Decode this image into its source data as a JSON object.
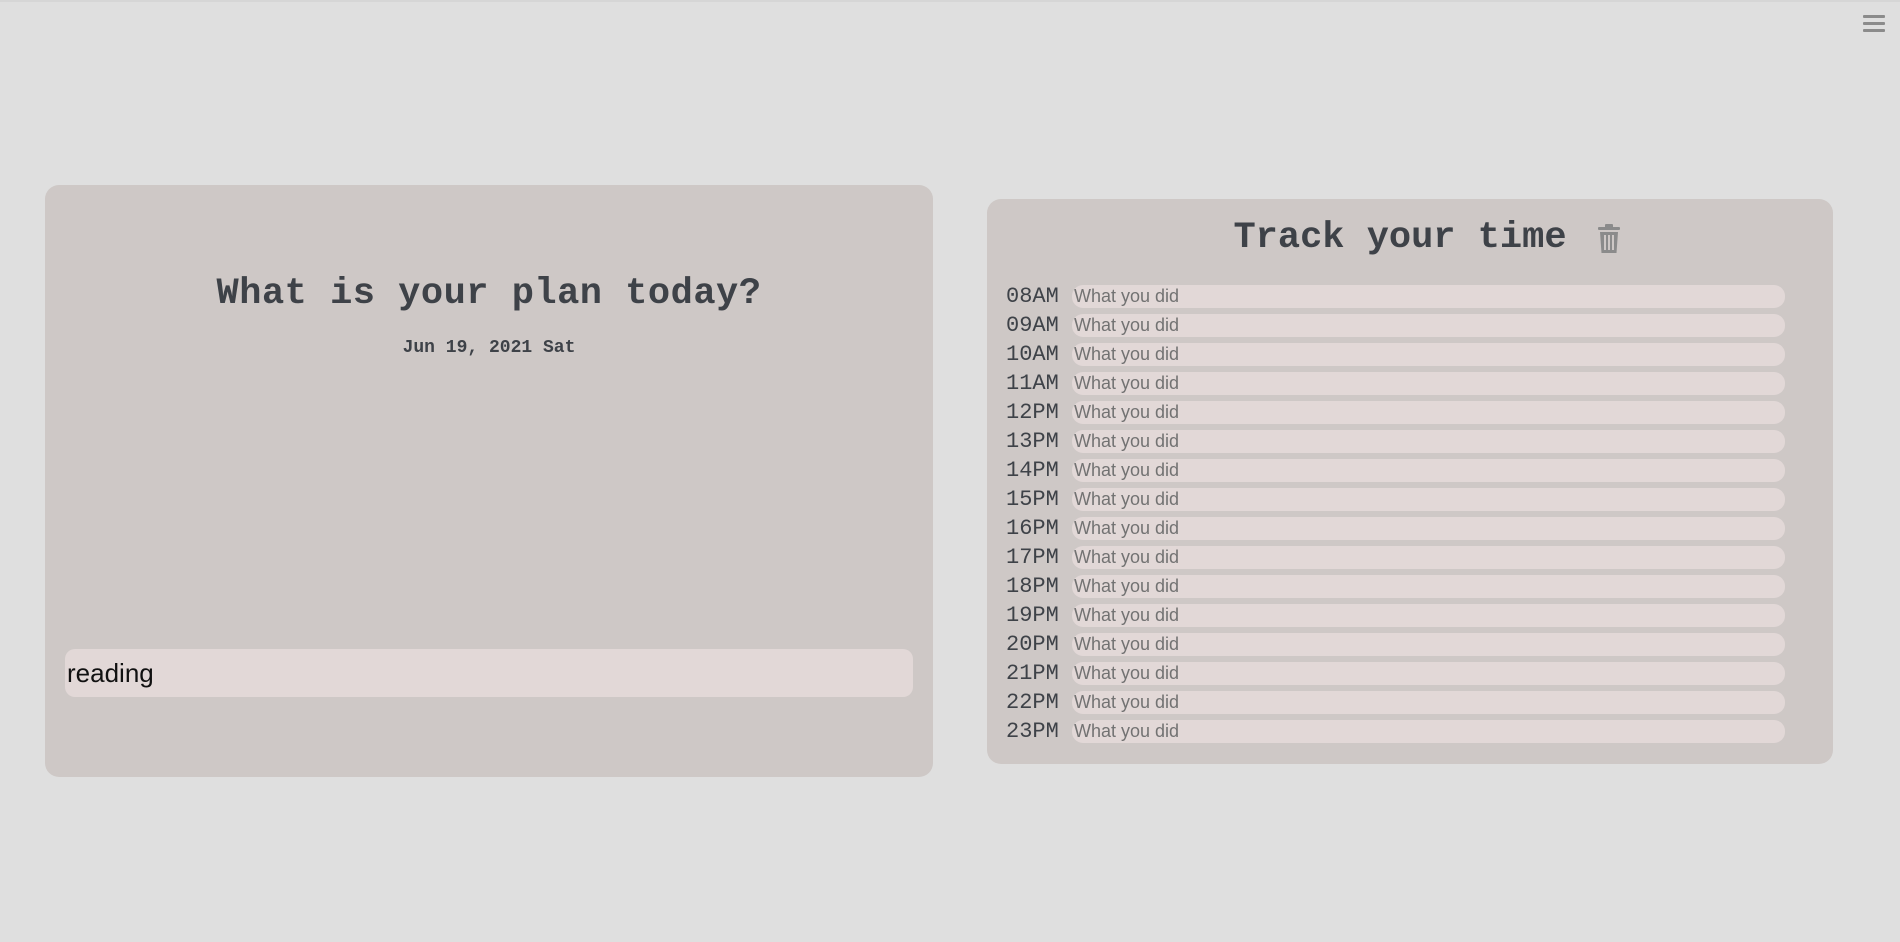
{
  "plan": {
    "title": "What is your plan today?",
    "date": "Jun 19, 2021 Sat",
    "input_value": "reading"
  },
  "track": {
    "title": "Track your time",
    "rows": [
      {
        "hour": "08AM",
        "placeholder": "What you did"
      },
      {
        "hour": "09AM",
        "placeholder": "What you did"
      },
      {
        "hour": "10AM",
        "placeholder": "What you did"
      },
      {
        "hour": "11AM",
        "placeholder": "What you did"
      },
      {
        "hour": "12PM",
        "placeholder": "What you did"
      },
      {
        "hour": "13PM",
        "placeholder": "What you did"
      },
      {
        "hour": "14PM",
        "placeholder": "What you did"
      },
      {
        "hour": "15PM",
        "placeholder": "What you did"
      },
      {
        "hour": "16PM",
        "placeholder": "What you did"
      },
      {
        "hour": "17PM",
        "placeholder": "What you did"
      },
      {
        "hour": "18PM",
        "placeholder": "What you did"
      },
      {
        "hour": "19PM",
        "placeholder": "What you did"
      },
      {
        "hour": "20PM",
        "placeholder": "What you did"
      },
      {
        "hour": "21PM",
        "placeholder": "What you did"
      },
      {
        "hour": "22PM",
        "placeholder": "What you did"
      },
      {
        "hour": "23PM",
        "placeholder": "What you did"
      }
    ]
  },
  "icons": {
    "menu": "hamburger-menu-icon",
    "clear": "trash-icon"
  },
  "colors": {
    "background": "#dfdfdf",
    "card": "#cec8c6",
    "input": "#e2d8d7",
    "text": "#3e4248",
    "icon": "#8b8b8b"
  }
}
